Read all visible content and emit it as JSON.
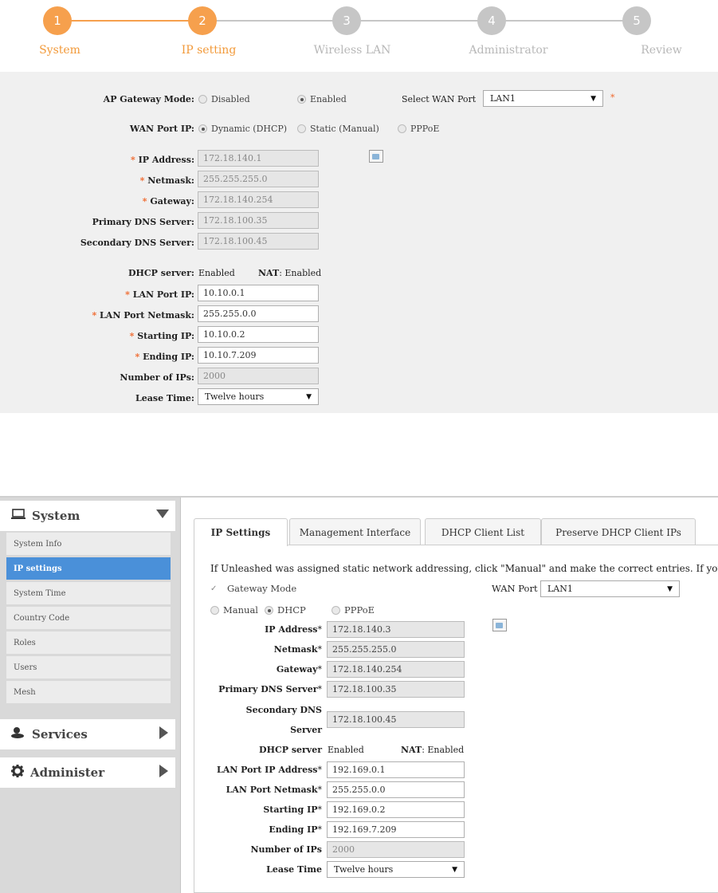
{
  "wizard": {
    "steps": [
      {
        "num": "1",
        "label": "System"
      },
      {
        "num": "2",
        "label": "IP setting"
      },
      {
        "num": "3",
        "label": "Wireless LAN"
      },
      {
        "num": "4",
        "label": "Administrator"
      },
      {
        "num": "5",
        "label": "Review"
      }
    ],
    "active_color": "#f6a04d",
    "inactive_color": "#c6c6c6",
    "form": {
      "ap_gateway_mode_label": "AP Gateway Mode:",
      "gw_disabled": "Disabled",
      "gw_enabled": "Enabled",
      "select_wan_port_label": "Select WAN Port",
      "wan_port_value": "LAN1",
      "asterisk": "*",
      "wan_port_ip_label": "WAN Port IP:",
      "wan_dynamic": "Dynamic (DHCP)",
      "wan_static": "Static (Manual)",
      "wan_pppoe": "PPPoE",
      "ip_address_label": "IP Address:",
      "ip_address": "172.18.140.1",
      "netmask_label": "Netmask:",
      "netmask": "255.255.255.0",
      "gateway_label": "Gateway:",
      "gateway": "172.18.140.254",
      "primary_dns_label": "Primary DNS Server:",
      "primary_dns": "172.18.100.35",
      "secondary_dns_label": "Secondary DNS Server:",
      "secondary_dns": "172.18.100.45",
      "dhcp_server_label": "DHCP server:",
      "dhcp_server_value": "Enabled",
      "nat_label": "NAT",
      "nat_value": ": Enabled",
      "lan_port_ip_label": "LAN Port IP:",
      "lan_port_ip": "10.10.0.1",
      "lan_port_netmask_label": "LAN Port Netmask:",
      "lan_port_netmask": "255.255.0.0",
      "starting_ip_label": "Starting IP:",
      "starting_ip": "10.10.0.2",
      "ending_ip_label": "Ending IP:",
      "ending_ip": "10.10.7.209",
      "num_ips_label": "Number of IPs:",
      "num_ips": "2000",
      "lease_time_label": "Lease Time:",
      "lease_time": "Twelve hours"
    }
  },
  "admin": {
    "sidebar": {
      "system_title": "System",
      "items": [
        "System Info",
        "IP settings",
        "System Time",
        "Country Code",
        "Roles",
        "Users",
        "Mesh"
      ],
      "selected": "IP settings",
      "services_title": "Services",
      "administer_title": "Administer",
      "accent": "#4a90d9"
    },
    "tabs": [
      "IP Settings",
      "Management Interface",
      "DHCP Client List",
      "Preserve DHCP Client IPs"
    ],
    "active_tab": "IP Settings",
    "form": {
      "intro": "If Unleashed was assigned static network addressing, click \"Manual\" and make the correct entries. If you click \"Dh",
      "gateway_mode": "Gateway Mode",
      "wan_port_label": "WAN Port",
      "wan_port_value": "LAN1",
      "manual": "Manual",
      "dhcp": "DHCP",
      "pppoe": "PPPoE",
      "star": "*",
      "ip_address_label": "IP Address",
      "ip_address": "172.18.140.3",
      "netmask_label": "Netmask",
      "netmask": "255.255.255.0",
      "gateway_label": "Gateway",
      "gateway": "172.18.140.254",
      "primary_dns_label": "Primary DNS Server",
      "primary_dns": "172.18.100.35",
      "secondary_dns_label_1": "Secondary DNS",
      "secondary_dns_label_2": "Server",
      "secondary_dns": "172.18.100.45",
      "dhcp_server_label": "DHCP server",
      "dhcp_server_value": "Enabled",
      "nat_label": "NAT",
      "nat_value": ": Enabled",
      "lan_port_ip_label": "LAN Port IP Address",
      "lan_port_ip": "192.169.0.1",
      "lan_port_netmask_label": "LAN Port Netmask",
      "lan_port_netmask": "255.255.0.0",
      "starting_ip_label": "Starting IP",
      "starting_ip": "192.169.0.2",
      "ending_ip_label": "Ending IP",
      "ending_ip": "192.169.7.209",
      "num_ips_label": "Number of IPs",
      "num_ips": "2000",
      "lease_time_label": "Lease Time",
      "lease_time": "Twelve hours"
    }
  }
}
